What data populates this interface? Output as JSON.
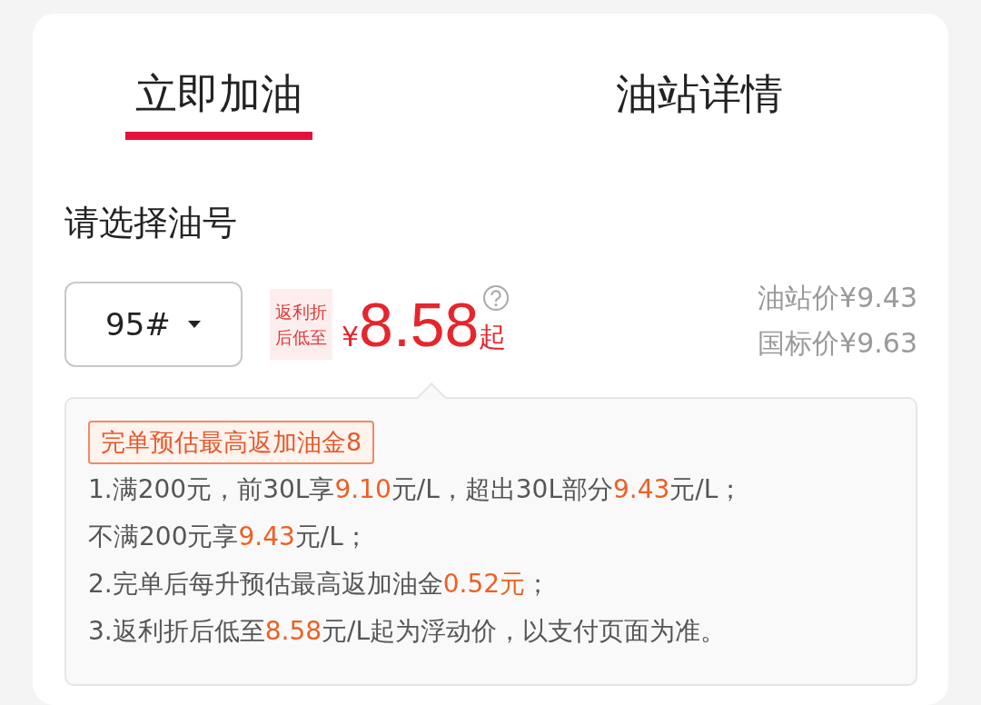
{
  "tabs": [
    {
      "label": "立即加油",
      "selected": true
    },
    {
      "label": "油站详情",
      "selected": false
    }
  ],
  "section_title": "请选择油号",
  "fuel_select": {
    "value": "95#"
  },
  "price": {
    "badge_lines": [
      "返利折",
      "后低至"
    ],
    "currency": "¥",
    "amount": "8.58",
    "suffix": "起"
  },
  "reference_prices": [
    "油站价¥9.43",
    "国标价¥9.63"
  ],
  "info": {
    "tag": "完单预估最高返加油金8",
    "lines": [
      [
        {
          "text": "1.满200元，前30L享",
          "highlight": false
        },
        {
          "text": "9.10",
          "highlight": true
        },
        {
          "text": "元/L，超出30L部分",
          "highlight": false
        },
        {
          "text": "9.43",
          "highlight": true
        },
        {
          "text": "元/L；",
          "highlight": false
        }
      ],
      [
        {
          "text": "不满200元享",
          "highlight": false
        },
        {
          "text": "9.43",
          "highlight": true
        },
        {
          "text": "元/L；",
          "highlight": false
        }
      ],
      [
        {
          "text": "2.完单后每升预估最高返加油金",
          "highlight": false
        },
        {
          "text": "0.52元",
          "highlight": true
        },
        {
          "text": "；",
          "highlight": false
        }
      ],
      [
        {
          "text": "3.返利折后低至",
          "highlight": false
        },
        {
          "text": "8.58",
          "highlight": true
        },
        {
          "text": "元/L起为浮动价，以支付页面为准。",
          "highlight": false
        }
      ]
    ]
  }
}
